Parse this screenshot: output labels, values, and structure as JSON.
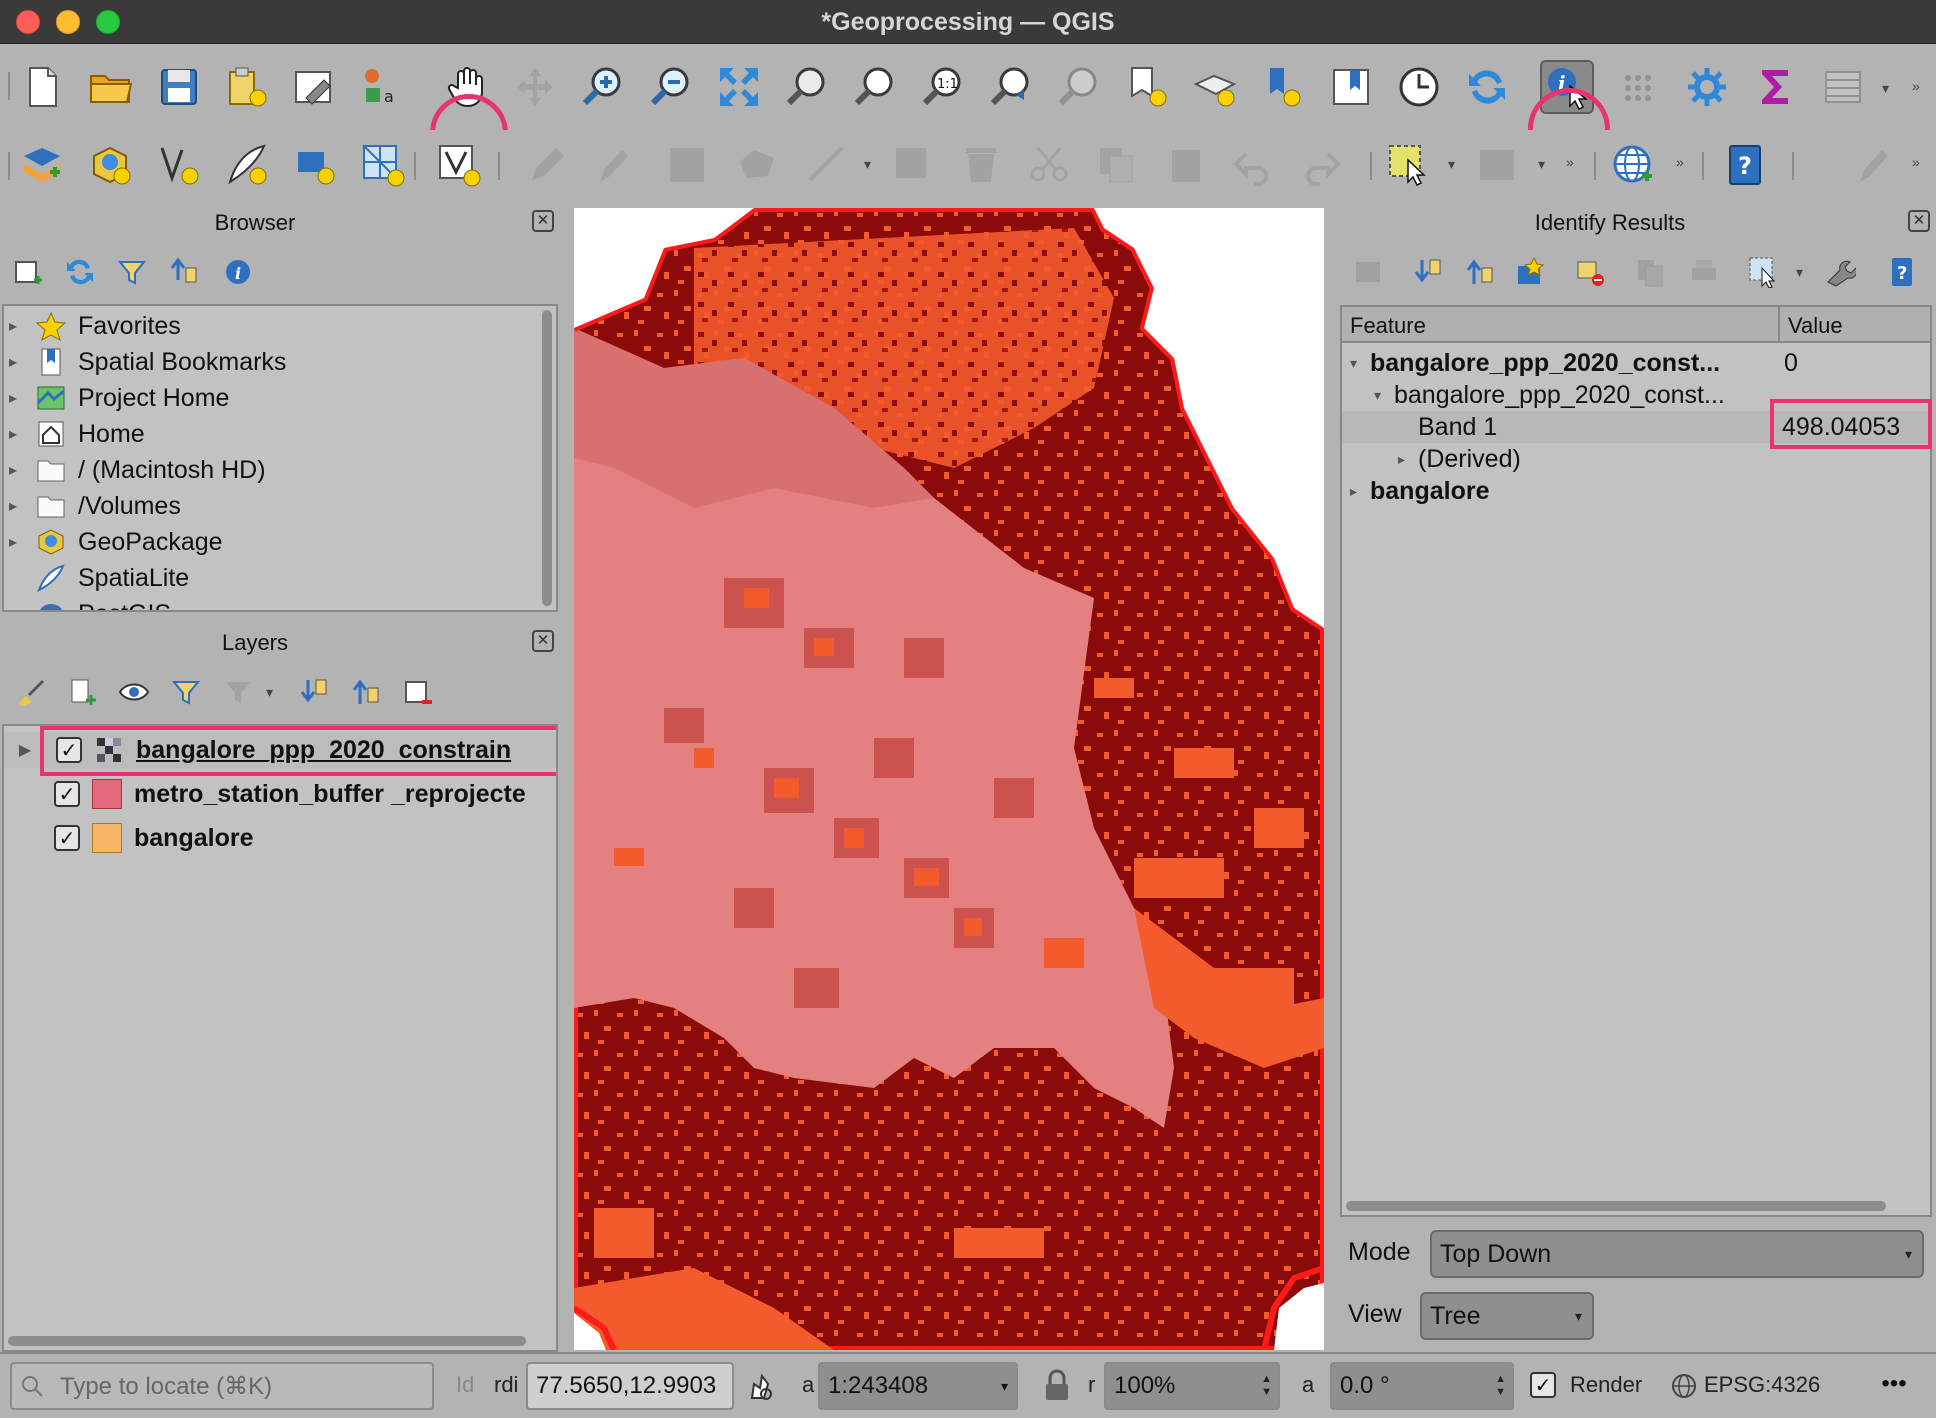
{
  "window": {
    "title": "*Geoprocessing — QGIS"
  },
  "browser": {
    "title": "Browser",
    "items": [
      {
        "label": "Favorites",
        "icon": "star-icon"
      },
      {
        "label": "Spatial Bookmarks",
        "icon": "bookmark-icon"
      },
      {
        "label": "Project Home",
        "icon": "project-home-icon"
      },
      {
        "label": "Home",
        "icon": "home-icon"
      },
      {
        "label": "/ (Macintosh HD)",
        "icon": "folder-icon"
      },
      {
        "label": "/Volumes",
        "icon": "folder-icon"
      },
      {
        "label": "GeoPackage",
        "icon": "geopackage-icon"
      },
      {
        "label": "SpatiaLite",
        "icon": "spatialite-icon"
      },
      {
        "label": "PostGIS",
        "icon": "postgis-icon"
      }
    ]
  },
  "layers": {
    "title": "Layers",
    "items": [
      {
        "label": "bangalore_ppp_2020_constrain",
        "checked": true,
        "swatch": "raster",
        "selected": true
      },
      {
        "label": "metro_station_buffer _reprojecte",
        "checked": true,
        "swatch": "#e3697e"
      },
      {
        "label": "bangalore",
        "checked": true,
        "swatch": "#f6b66a"
      }
    ]
  },
  "identify": {
    "title": "Identify Results",
    "columns": {
      "feature": "Feature",
      "value": "Value"
    },
    "rows": [
      {
        "feature": "bangalore_ppp_2020_const...",
        "value": "0"
      },
      {
        "feature": "bangalore_ppp_2020_const...",
        "value": ""
      },
      {
        "feature": "Band 1",
        "value": "498.04053"
      },
      {
        "feature": "(Derived)",
        "value": ""
      },
      {
        "feature": "bangalore",
        "value": ""
      }
    ],
    "mode_label": "Mode",
    "mode_value": "Top Down",
    "view_label": "View",
    "view_value": "Tree"
  },
  "statusbar": {
    "locator_placeholder": "Type to locate (⌘K)",
    "coordinate_label": "rdi",
    "coordinate": "77.5650,12.9903",
    "scale_label": "a",
    "scale": "1:243408",
    "magnifier_label": "r",
    "magnifier": "100%",
    "rotation_label": "a",
    "rotation": "0.0 °",
    "render_label": "Render",
    "crs": "EPSG:4326",
    "id_label": "Id"
  },
  "colors": {
    "highlight": "#e8336f",
    "map_dark": "#8b0a0a",
    "map_orange": "#f35a2c",
    "map_pink": "#e48080",
    "map_border": "#ff1a1a"
  }
}
